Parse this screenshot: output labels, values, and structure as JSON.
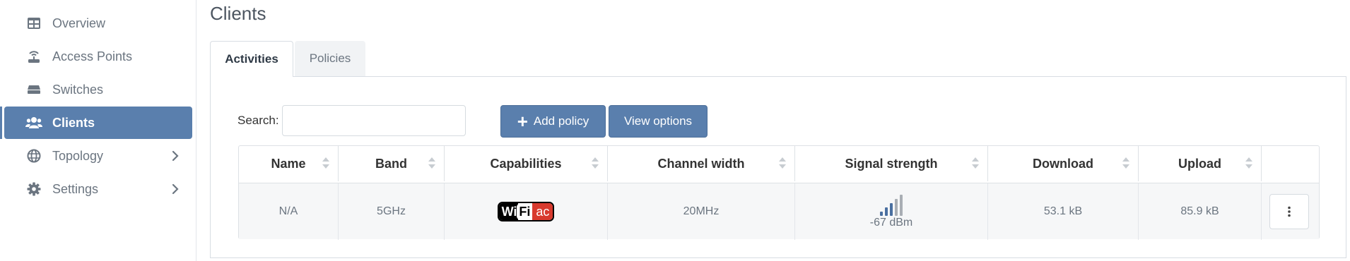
{
  "sidebar": {
    "items": [
      {
        "label": "Overview",
        "icon": "table-icon"
      },
      {
        "label": "Access Points",
        "icon": "router-icon"
      },
      {
        "label": "Switches",
        "icon": "switch-icon"
      },
      {
        "label": "Clients",
        "icon": "users-icon",
        "active": true
      },
      {
        "label": "Topology",
        "icon": "globe-icon",
        "has_children": true
      },
      {
        "label": "Settings",
        "icon": "gear-icon",
        "has_children": true
      }
    ]
  },
  "page": {
    "title": "Clients"
  },
  "tabs": [
    {
      "label": "Activities",
      "active": true
    },
    {
      "label": "Policies",
      "active": false
    }
  ],
  "toolbar": {
    "search_label": "Search:",
    "search_value": "",
    "add_policy_label": "Add policy",
    "view_options_label": "View options"
  },
  "table": {
    "columns": [
      "Name",
      "Band",
      "Capabilities",
      "Channel width",
      "Signal strength",
      "Download",
      "Upload",
      ""
    ],
    "rows": [
      {
        "name": "N/A",
        "band": "5GHz",
        "capabilities": {
          "wi": "Wi",
          "fi": "Fi",
          "ac": "ac"
        },
        "channel_width": "20MHz",
        "signal": {
          "text": "-67 dBm",
          "level": 3,
          "max": 5
        },
        "download": "53.1 kB",
        "upload": "85.9 kB"
      }
    ]
  },
  "colors": {
    "accent": "#5a7fad",
    "signal_active": "#4a6fa0",
    "signal_inactive": "#a9aeb4",
    "wifi_ac": "#d83a2e"
  }
}
